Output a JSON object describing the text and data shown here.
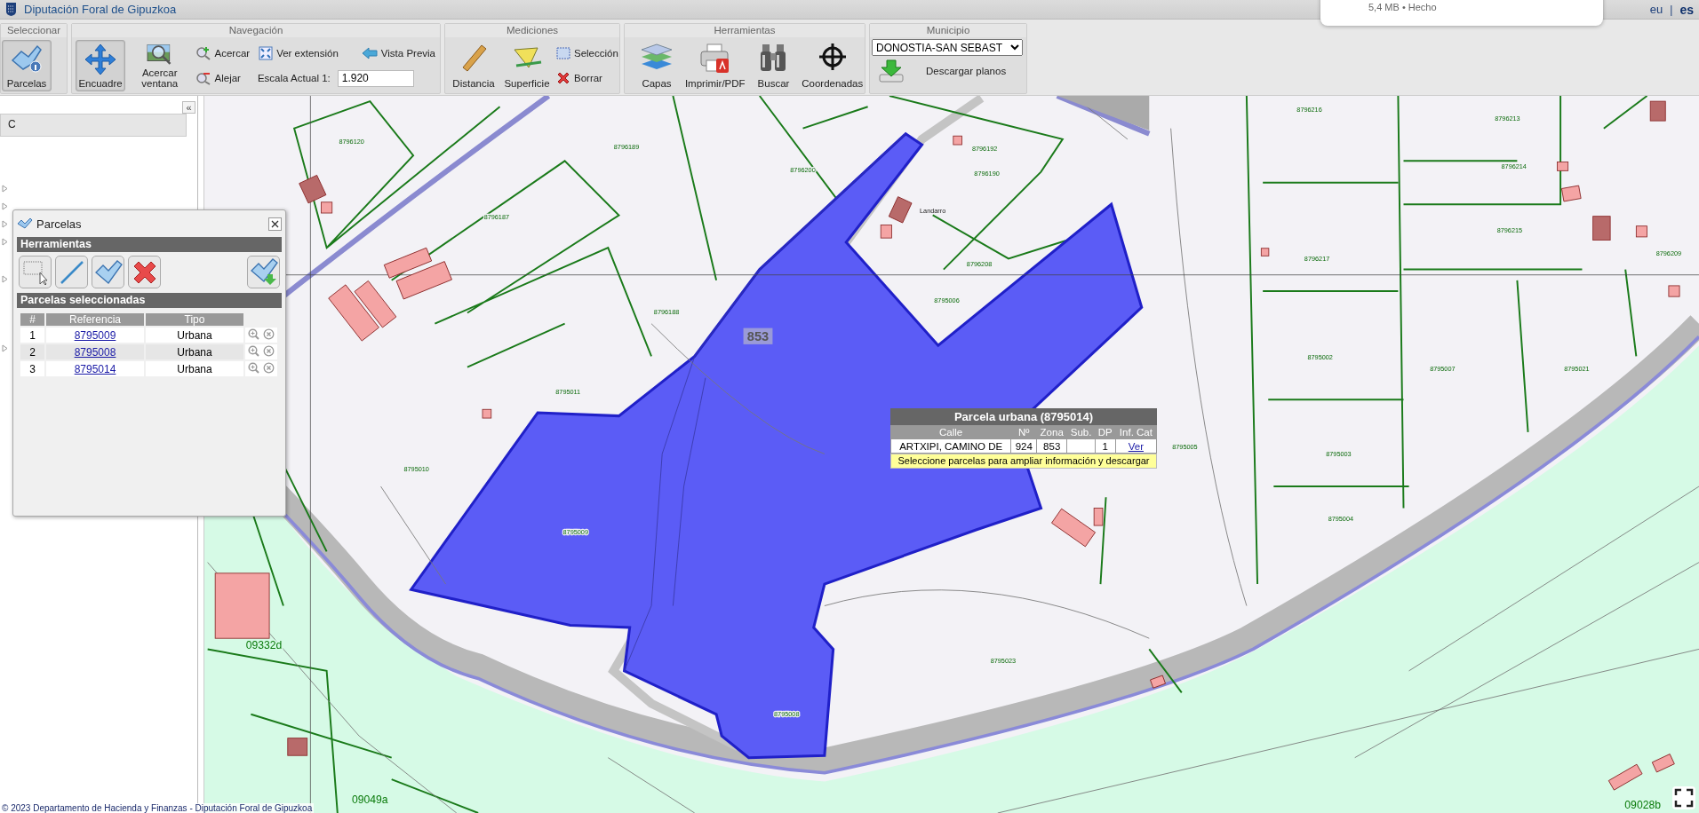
{
  "header": {
    "title": "Diputación Foral de Gipuzkoa",
    "languages": [
      {
        "label": "eu",
        "selected": false
      },
      {
        "label": "es",
        "selected": true
      }
    ],
    "separator": "|"
  },
  "download_notice": {
    "text": "5,4 MB • Hecho"
  },
  "toolbar": {
    "seleccionar": {
      "title": "Seleccionar",
      "buttons": [
        {
          "label": "Parcelas",
          "selected": true
        }
      ]
    },
    "navegacion": {
      "title": "Navegación",
      "buttons": [
        {
          "label": "Encuadre",
          "selected": true
        },
        {
          "label": "Acercar ventana",
          "selected": false
        }
      ],
      "small_buttons": [
        "Acercar",
        "Ver extensión",
        "Vista Previa",
        "Alejar"
      ],
      "scale": {
        "label": "Escala Actual 1:",
        "value": "1.920"
      }
    },
    "mediciones": {
      "title": "Mediciones",
      "buttons": [
        {
          "label": "Distancia",
          "selected": false
        },
        {
          "label": "Superficie",
          "selected": false
        }
      ],
      "small_buttons": [
        "Selección",
        "Borrar"
      ]
    },
    "herramientas": {
      "title": "Herramientas",
      "buttons": [
        {
          "label": "Capas",
          "selected": false
        },
        {
          "label": "Imprimir/PDF",
          "selected": false
        },
        {
          "label": "Buscar",
          "selected": false
        },
        {
          "label": "Coordenadas",
          "selected": false
        }
      ]
    },
    "municipio": {
      "title": "Municipio",
      "select": {
        "value": "DONOSTIA-SAN SEBAST"
      },
      "button": "Descargar planos"
    }
  },
  "sidebar": {
    "tab": "C",
    "collapse": "«"
  },
  "parcel_window": {
    "title": "Parcelas",
    "tools_heading": "Herramientas",
    "list_heading": "Parcelas seleccionadas",
    "columns": [
      "#",
      "Referencia",
      "Tipo"
    ],
    "rows": [
      {
        "index": "1",
        "reference": "8795009",
        "type": "Urbana"
      },
      {
        "index": "2",
        "reference": "8795008",
        "type": "Urbana"
      },
      {
        "index": "3",
        "reference": "8795014",
        "type": "Urbana"
      }
    ]
  },
  "map": {
    "zone_label": "853",
    "parcel_labels": [
      "8796216",
      "8796213",
      "8796120",
      "8796189",
      "8796192",
      "8796214",
      "8796200",
      "8796190",
      "8796187",
      "8796215",
      "8796208",
      "8796209",
      "8796217",
      "8795006",
      "8796188",
      "8795002",
      "8795007",
      "8795021",
      "8795011",
      "8795005",
      "8795003",
      "8795010",
      "8795004",
      "8795009",
      "8795023",
      "8795008"
    ],
    "area_labels": [
      "09332d",
      "09049a",
      "09028b"
    ],
    "place_labels": [
      "Landarro"
    ]
  },
  "popup": {
    "title": "Parcela urbana (8795014)",
    "columns": [
      "Calle",
      "Nº",
      "Zona",
      "Sub.",
      "DP",
      "Inf. Cat"
    ],
    "row": {
      "street": "ARTXIPI, CAMINO DE",
      "number": "924",
      "zone": "853",
      "dp": "1",
      "link": "Ver"
    },
    "hint": "Seleccione parcelas para ampliar información y descargar"
  },
  "footer": {
    "text": "© 2023 Departamento de Hacienda y Finanzas - Diputación Foral de Gipuzkoa"
  }
}
